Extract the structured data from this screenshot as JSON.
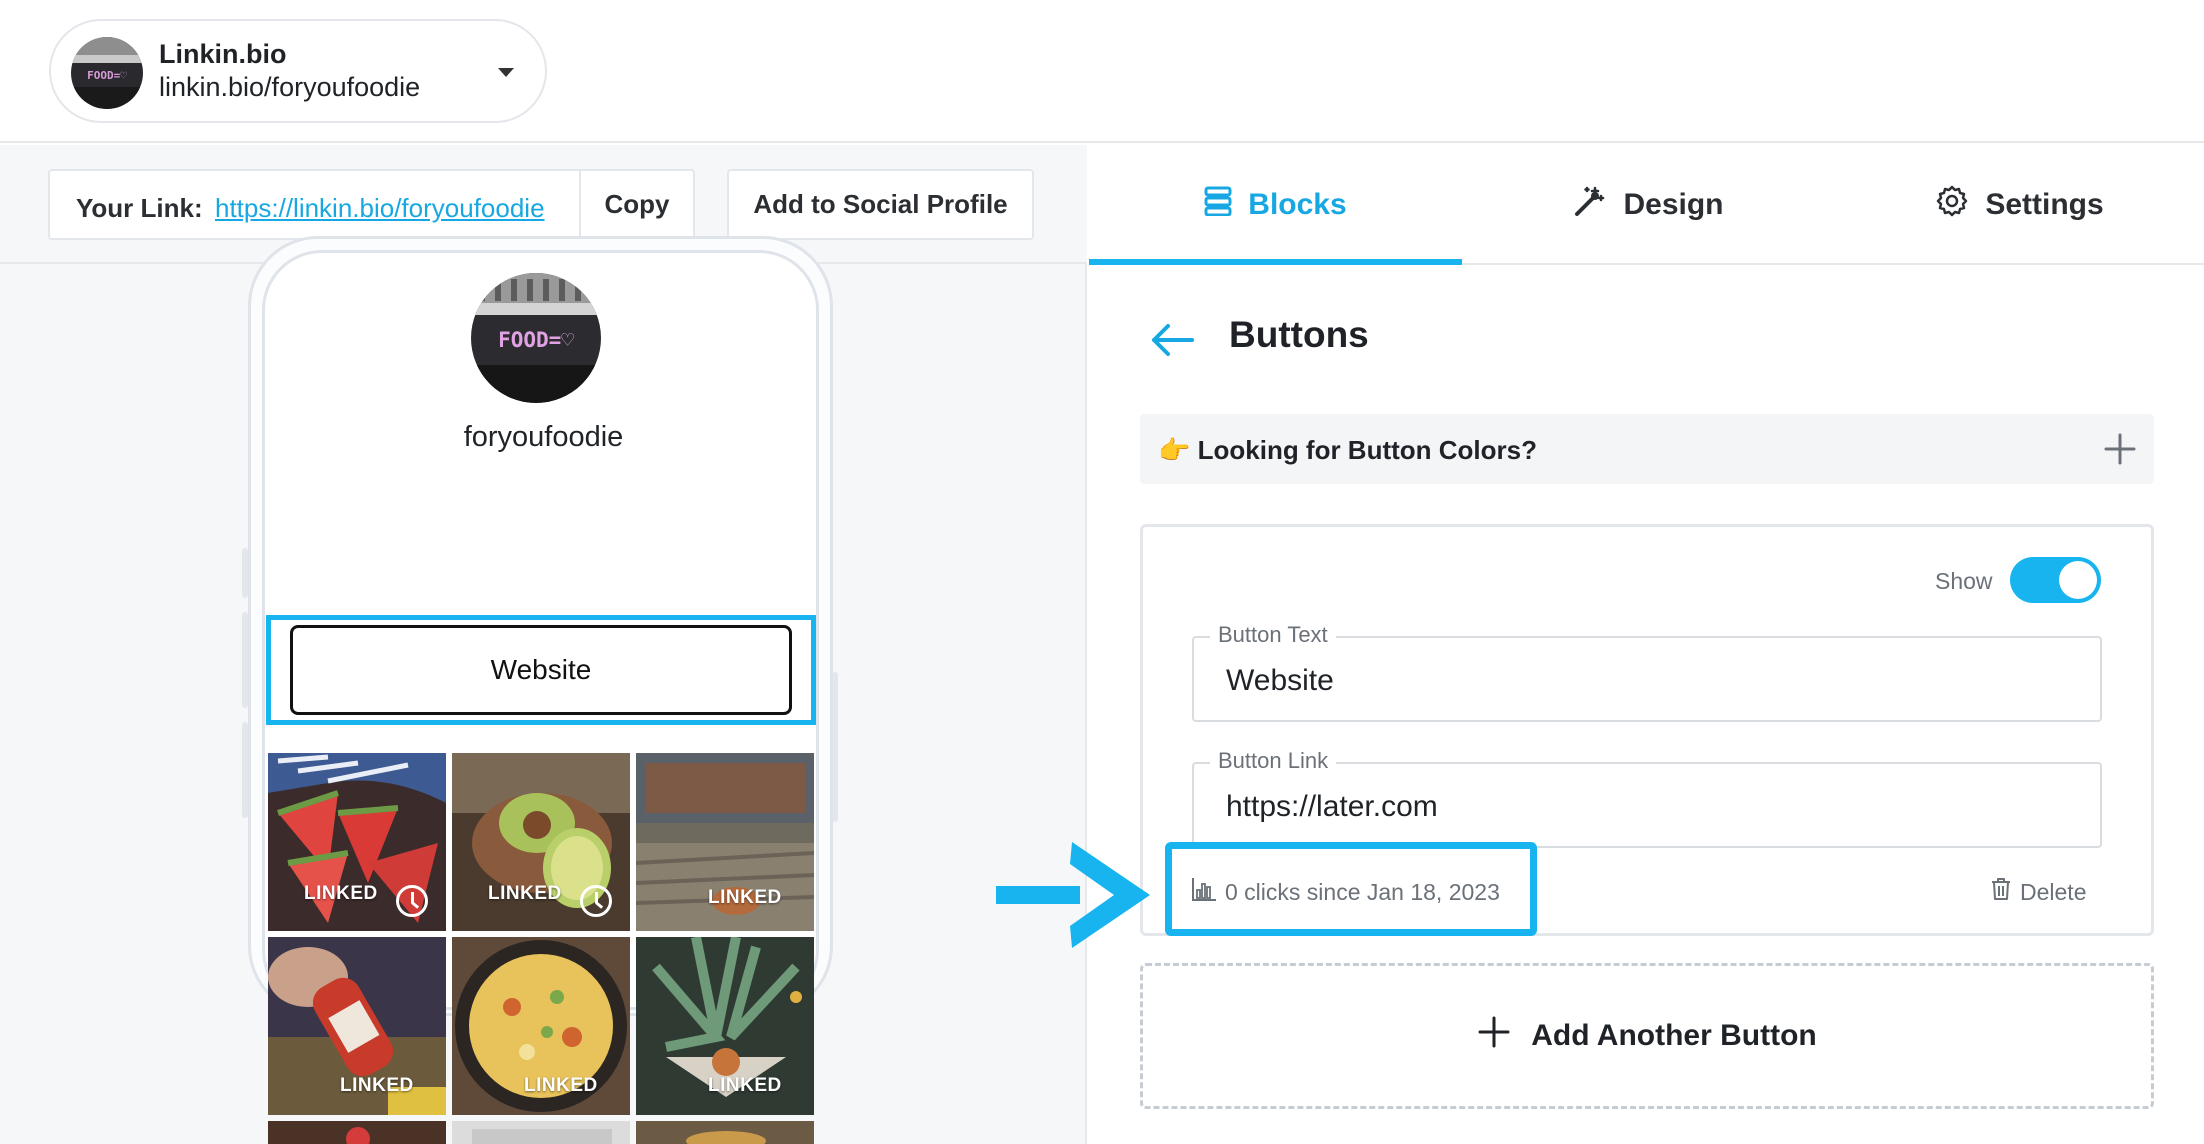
{
  "account": {
    "name": "Linkin.bio",
    "handle": "linkin.bio/foryoufoodie",
    "avatar_text": "FOOD=♡"
  },
  "linkbar": {
    "label": "Your Link:",
    "url": "https://linkin.bio/foryoufoodie",
    "copy_label": "Copy",
    "social_label": "Add to Social Profile"
  },
  "preview": {
    "profile_name": "foryoufoodie",
    "website_button": "Website",
    "tiles": [
      {
        "tag": "LINKED",
        "clock": true
      },
      {
        "tag": "LINKED",
        "clock": true
      },
      {
        "tag": "LINKED",
        "clock": false
      },
      {
        "tag": "LINKED",
        "clock": false
      },
      {
        "tag": "LINKED",
        "clock": false
      },
      {
        "tag": "LINKED",
        "clock": false
      }
    ]
  },
  "tabs": [
    {
      "label": "Blocks",
      "icon": "blocks-icon",
      "active": true
    },
    {
      "label": "Design",
      "icon": "magic-wand-icon",
      "active": false
    },
    {
      "label": "Settings",
      "icon": "gear-icon",
      "active": false
    }
  ],
  "panel": {
    "title": "Buttons",
    "colors_prompt": "Looking for Button Colors?",
    "colors_emoji": "👉",
    "show_label": "Show",
    "show_on": true,
    "button_text_label": "Button Text",
    "button_text_value": "Website",
    "button_link_label": "Button Link",
    "button_link_value": "https://later.com",
    "clicks_text": "0 clicks since Jan 18, 2023",
    "delete_label": "Delete",
    "add_label": "Add Another Button"
  },
  "colors": {
    "accent": "#17b4ef",
    "link": "#17a8e3"
  }
}
